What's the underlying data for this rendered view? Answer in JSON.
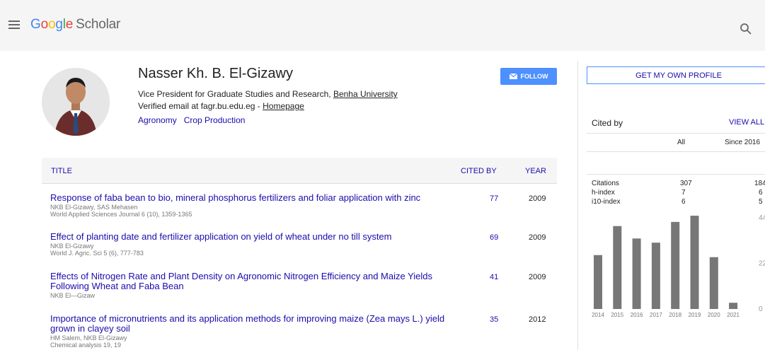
{
  "header": {
    "logo_parts": [
      "G",
      "o",
      "o",
      "g",
      "l",
      "e"
    ],
    "logo_scholar": "Scholar"
  },
  "profile": {
    "name": "Nasser Kh. B. El-Gizawy",
    "affiliation_prefix": "Vice President for Graduate Studies and Research, ",
    "affiliation_link": "Benha University",
    "email_text": "Verified email at fagr.bu.edu.eg - ",
    "homepage_label": "Homepage",
    "interests": [
      "Agronomy",
      "Crop Production"
    ],
    "follow_label": "FOLLOW"
  },
  "table": {
    "headers": {
      "title": "TITLE",
      "cited_by": "CITED BY",
      "year": "YEAR"
    },
    "rows": [
      {
        "title": "Response of faba bean to bio, mineral phosphorus fertilizers and foliar application with zinc",
        "authors": "NKB El-Gizawy, SAS Mehasen",
        "venue": "World Applied Sciences Journal 6 (10), 1359-1365",
        "cited": "77",
        "year": "2009"
      },
      {
        "title": "Effect of planting date and fertilizer application on yield of wheat under no till system",
        "authors": "NKB El-Gizawy",
        "venue": "World J. Agric. Sci 5 (6), 777-783",
        "cited": "69",
        "year": "2009"
      },
      {
        "title": "Effects of Nitrogen Rate and Plant Density on Agronomic Nitrogen Efficiency and Maize Yields Following Wheat and Faba Bean",
        "authors": "NKB El—Gizaw",
        "venue": "",
        "cited": "41",
        "year": "2009"
      },
      {
        "title": "Importance of micronutrients and its application methods for improving maize (Zea mays L.) yield grown in clayey soil",
        "authors": "HM Salem, NKB El-Gizawy",
        "venue": "Chemical analysis 19, 19",
        "cited": "35",
        "year": "2012"
      }
    ]
  },
  "sidebar": {
    "get_profile_label": "GET MY OWN PROFILE",
    "cited_by_label": "Cited by",
    "view_all_label": "VIEW ALL",
    "col_all": "All",
    "col_since": "Since 2016",
    "stats": [
      {
        "label": "Citations",
        "all": "307",
        "since": "184"
      },
      {
        "label": "h-index",
        "all": "7",
        "since": "6"
      },
      {
        "label": "i10-index",
        "all": "6",
        "since": "5"
      }
    ]
  },
  "chart_data": {
    "type": "bar",
    "categories": [
      "2014",
      "2015",
      "2016",
      "2017",
      "2018",
      "2019",
      "2020",
      "2021"
    ],
    "values": [
      26,
      40,
      34,
      32,
      42,
      45,
      25,
      3
    ],
    "ylim": [
      0,
      44
    ],
    "ytick_labels": [
      "44",
      "22",
      "0"
    ],
    "bar_color": "#777777"
  }
}
